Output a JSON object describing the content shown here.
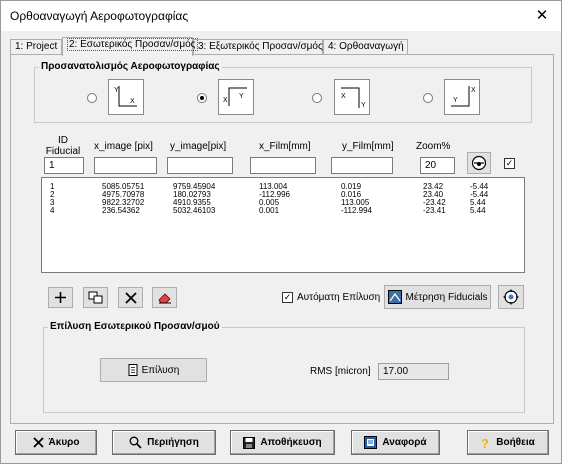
{
  "window": {
    "title": "Ορθοαναγωγή Αεροφωτογραφίας",
    "close_symbol": "✕"
  },
  "tabs": [
    {
      "label": "1: Project"
    },
    {
      "label": "2: Εσωτερικός Προσαν/σμός"
    },
    {
      "label": "3: Εξωτερικός Προσαν/σμός"
    },
    {
      "label": "4: Ορθοαναγωγή"
    }
  ],
  "orientation": {
    "title": "Προσανατολισμός Αεροφωτογραφίας",
    "selected_index": 1,
    "options": [
      {
        "x_label": "X",
        "y_label": "Y"
      },
      {
        "x_label": "X",
        "y_label": "Y"
      },
      {
        "x_label": "X",
        "y_label": "Y"
      },
      {
        "x_label": "X",
        "y_label": "Y"
      }
    ]
  },
  "fiducial_form": {
    "id_label": "ID\nFiducial",
    "id_value": "1",
    "x_image_label": "x_image [pix]",
    "y_image_label": "y_image[pix]",
    "x_film_label": "x_Film[mm]",
    "y_film_label": "y_Film[mm]",
    "zoom_label": "Zoom%",
    "x_image_value": "",
    "y_image_value": "",
    "x_film_value": "",
    "y_film_value": "",
    "zoom_value": "20",
    "show_checked": true
  },
  "fiducials": [
    {
      "id": "1",
      "x_image": "5085.05751",
      "y_image": "9759.45904",
      "x_film": "113.004",
      "y_film": "0.019",
      "res_x": "23.42",
      "res_y": "-5.44"
    },
    {
      "id": "2",
      "x_image": "4975.70978",
      "y_image": "180.02793",
      "x_film": "-112.996",
      "y_film": "0.016",
      "res_x": "23.40",
      "res_y": "-5.44"
    },
    {
      "id": "3",
      "x_image": "9822.32702",
      "y_image": "4910.9355",
      "x_film": "0.005",
      "y_film": "113.005",
      "res_x": "-23.42",
      "res_y": "5.44"
    },
    {
      "id": "4",
      "x_image": "236.54362",
      "y_image": "5032.46103",
      "x_film": "0.001",
      "y_film": "-112.994",
      "res_x": "-23.41",
      "res_y": "5.44"
    }
  ],
  "toolbar": {
    "auto_solve_label": "Αυτόματη Επίλυση",
    "auto_solve_checked": true,
    "measure_label": "Μέτρηση Fiducials"
  },
  "solution": {
    "title": "Επίλυση Εσωτερικού Προσαν/σμού",
    "solve_label": "Επίλυση",
    "rms_label": "RMS [micron]",
    "rms_value": "17.00"
  },
  "bottom": {
    "cancel": "Άκυρο",
    "browse": "Περιήγηση",
    "save": "Αποθήκευση",
    "report": "Αναφορά",
    "help": "Βοήθεια"
  },
  "colors": {
    "window_bg": "#f0f0f0",
    "button_bg": "#e1e1e1",
    "help_icon": "#e6b800",
    "report_icon": "#1e5fb0"
  }
}
